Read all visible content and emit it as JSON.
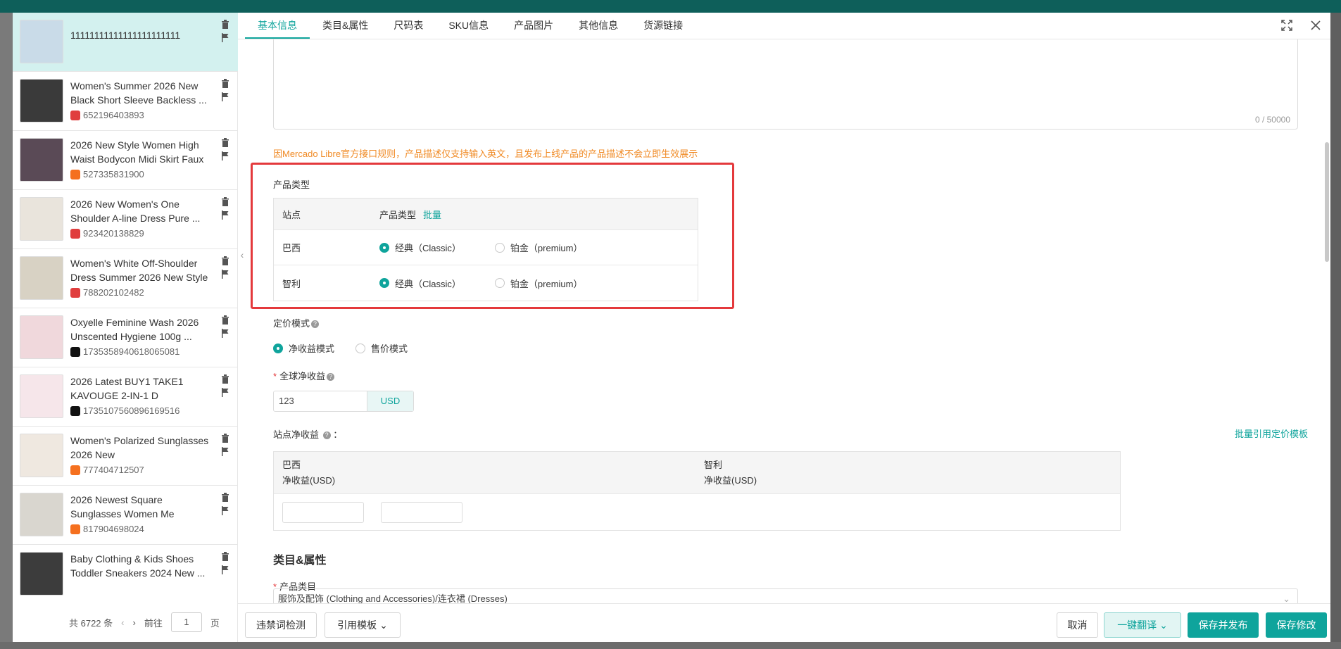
{
  "left_list": {
    "items": [
      {
        "title": "11111111111111111111111",
        "id": "",
        "platform": "",
        "active": true
      },
      {
        "title": "Women's Summer 2026 New Black Short Sleeve Backless ...",
        "id": "652196403893",
        "platform": "shopee"
      },
      {
        "title": "2026 New Style Women High Waist Bodycon Midi Skirt Faux ...",
        "id": "527335831900",
        "platform": "ali"
      },
      {
        "title": "2026 New Women's One Shoulder A-line Dress Pure ...",
        "id": "923420138829",
        "platform": "shopee"
      },
      {
        "title": "Women's White Off-Shoulder Dress Summer 2026 New Style ...",
        "id": "788202102482",
        "platform": "shopee"
      },
      {
        "title": "Oxyelle Feminine Wash 2026 Unscented Hygiene 100g ...",
        "id": "1735358940618065081",
        "platform": "tiktok"
      },
      {
        "title": "2026 Latest BUY1 TAKE1 KAVOUGE 2-IN-1 D",
        "id": "1735107560896169516",
        "platform": "tiktok"
      },
      {
        "title": "Women's Polarized Sunglasses 2026 New",
        "id": "777404712507",
        "platform": "ali"
      },
      {
        "title": "2026 Newest Square Sunglasses Women Me",
        "id": "817904698024",
        "platform": "ali"
      },
      {
        "title": "Baby Clothing & Kids Shoes Toddler Sneakers 2024 New ...",
        "id": "",
        "platform": ""
      }
    ],
    "pager": {
      "total": "共 6722 条",
      "goto": "前往",
      "page": "1",
      "page_unit": "页"
    }
  },
  "tabs": [
    "基本信息",
    "类目&属性",
    "尺码表",
    "SKU信息",
    "产品图片",
    "其他信息",
    "货源链接"
  ],
  "description": {
    "counter": "0 / 50000",
    "warning": "因Mercado Libre官方接口规则，产品描述仅支持输入英文，且发布上线产品的产品描述不会立即生效展示"
  },
  "product_type": {
    "label": "产品类型",
    "col_site": "站点",
    "col_type": "产品类型",
    "batch": "批量",
    "option_classic": "经典（Classic）",
    "option_premium": "铂金（premium）",
    "rows": [
      {
        "site": "巴西"
      },
      {
        "site": "智利"
      }
    ]
  },
  "pricing": {
    "label": "定价模式",
    "mode_net": "净收益模式",
    "mode_sale": "售价模式",
    "global_net_label": "全球净收益",
    "global_net_value": "123",
    "currency": "USD",
    "site_net_label": "站点净收益",
    "batch_template": "批量引用定价模板",
    "sites": [
      {
        "name": "巴西",
        "sub": "净收益(USD)"
      },
      {
        "name": "智利",
        "sub": "净收益(USD)"
      }
    ]
  },
  "category": {
    "heading": "类目&属性",
    "label": "产品类目",
    "value": "服饰及配饰 (Clothing and Accessories)/连衣裙 (Dresses)"
  },
  "footer": {
    "check": "违禁词检测",
    "template": "引用模板",
    "cancel": "取消",
    "translate": "一键翻译",
    "save_publish": "保存并发布",
    "save_edit": "保存修改"
  },
  "colors": {
    "accent": "#0fa49c",
    "warning": "#f08a24",
    "highlight": "#e4393c"
  }
}
